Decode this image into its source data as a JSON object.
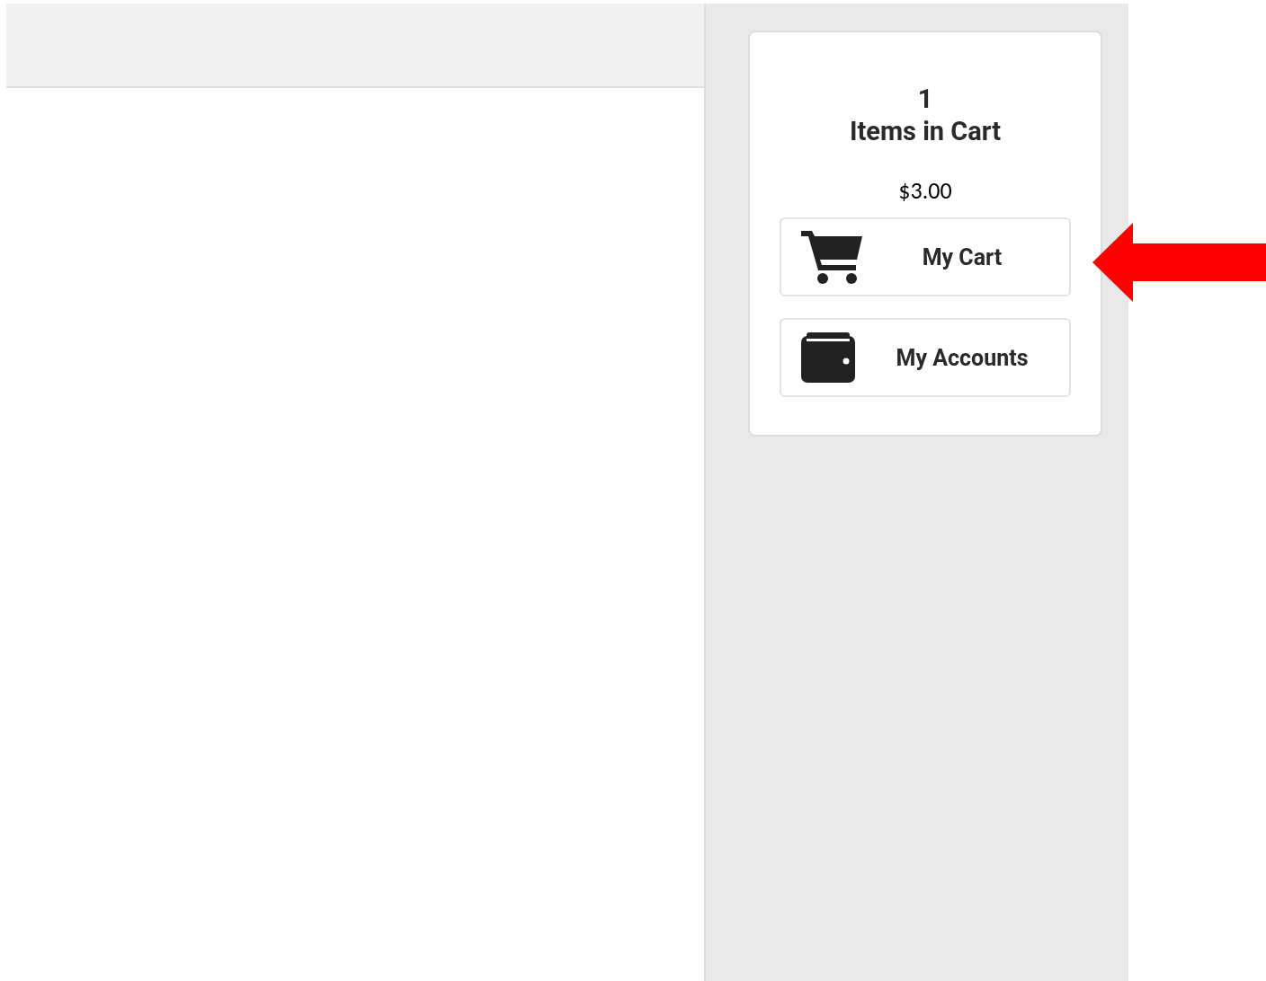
{
  "cart": {
    "count": "1",
    "label": "Items in Cart",
    "total": "$3.00"
  },
  "buttons": [
    {
      "kind": "cart",
      "label": "My Cart"
    },
    {
      "kind": "accounts",
      "label": "My Accounts"
    }
  ]
}
